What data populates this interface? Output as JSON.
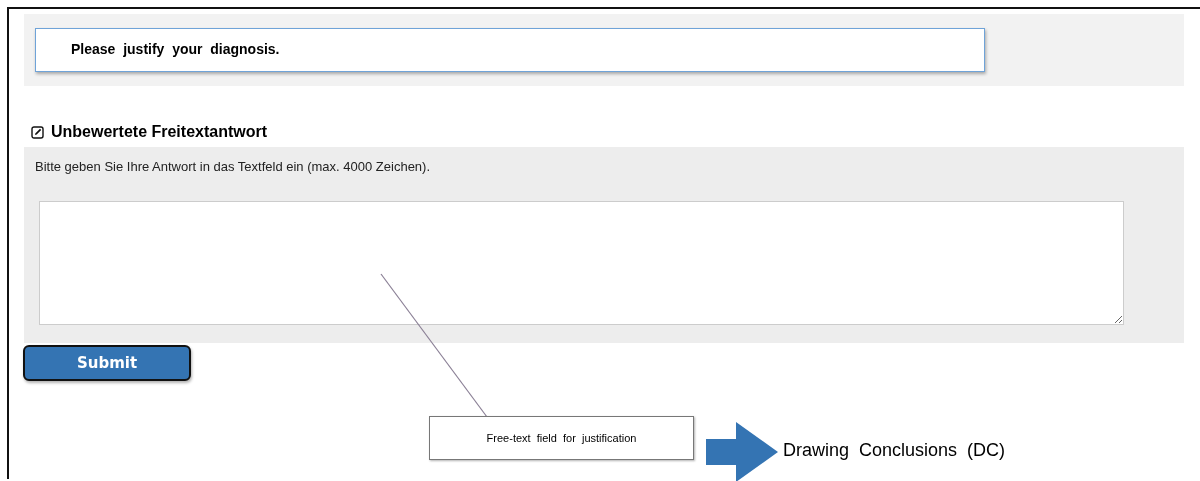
{
  "question": {
    "text": "Please  justify  your  diagnosis."
  },
  "section": {
    "title": "Unbewertete Freitextantwort",
    "instruction": "Bitte geben Sie Ihre Antwort in das Textfeld ein (max. 4000 Zeichen)."
  },
  "submit_button": {
    "label": "Submit"
  },
  "annotation": {
    "callout": "Free-text  field  for  justification",
    "result": "Drawing  Conclusions  (DC)"
  }
}
